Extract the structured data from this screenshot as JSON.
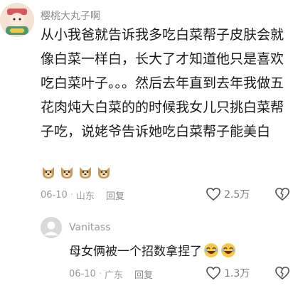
{
  "comment1": {
    "username": "樱桃大丸子啊",
    "body": "从小我爸就告诉我多吃白菜帮子皮肤会就像白菜一样白，长大了才知道他只是喜欢吃白菜叶子。。。然后去年直到去年我做五花肉炖大白菜的的时候我女儿只挑白菜帮子吃，说姥爷告诉她吃白菜帮子能美白",
    "date": "06-10",
    "location": "山东",
    "reply_label": "回复",
    "likes": "2.5万",
    "emoji_count": 4
  },
  "comment2": {
    "username": "Vanitass",
    "body": "母女俩被一个招数拿捏了",
    "date": "06-10",
    "location": "广东",
    "reply_label": "回复",
    "likes": "1.3万"
  }
}
